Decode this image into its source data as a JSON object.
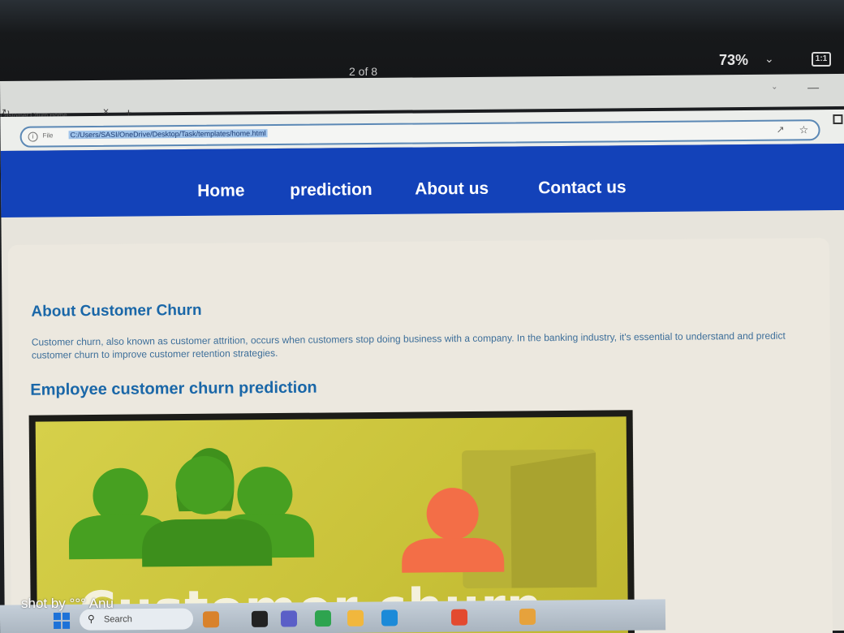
{
  "viewer": {
    "page_counter": "2 of 8",
    "zoom": "73%",
    "fit_label": "1:1"
  },
  "browser": {
    "tab_title": "Customer Churn Home",
    "file_label": "File",
    "url": "C:/Users/SASI/OneDrive/Desktop/Task/templates/home.html"
  },
  "site": {
    "nav": {
      "home": "Home",
      "prediction": "prediction",
      "about": "About us",
      "contact": "Contact us"
    },
    "about_title": "About Customer Churn",
    "about_text": "Customer churn, also known as customer attrition, occurs when customers stop doing business with a company. In the banking industry, it's essential to understand and predict customer churn to improve customer retention strategies.",
    "section_title": "Employee customer churn prediction",
    "hero_caption": "Customer churn"
  },
  "overlay": {
    "watermark": "shot by °°° Anu"
  },
  "taskbar": {
    "search_label": "Search"
  },
  "colors": {
    "nav_bg": "#1342b9",
    "heading": "#1a67a8",
    "hero_bg": "#d6d04a",
    "people_green": "#47a021",
    "person_orange": "#f36e47"
  }
}
